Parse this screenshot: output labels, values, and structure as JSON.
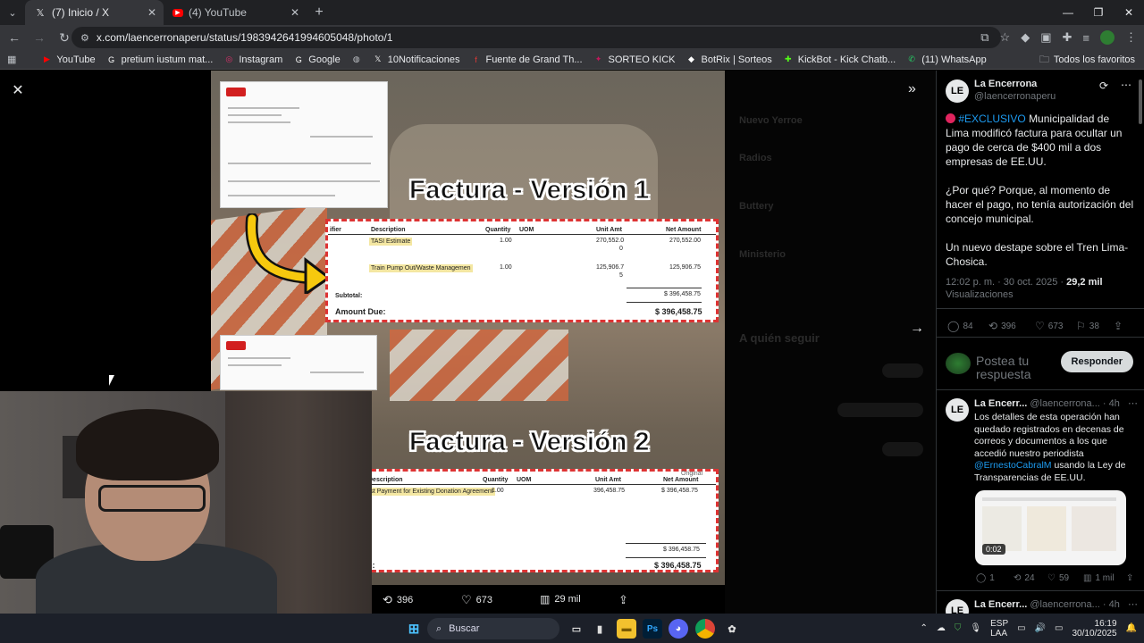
{
  "browser": {
    "tabs": [
      {
        "title": "(7) Inicio / X",
        "favicon": "x-logo-icon",
        "active": true
      },
      {
        "title": "(4) YouTube",
        "favicon": "youtube-icon",
        "active": false
      }
    ],
    "url": "x.com/laencerronaperu/status/1983942641994605048/photo/1",
    "bookmarks": [
      {
        "label": "YouTube",
        "icon": "youtube-icon",
        "color": "#ff0000"
      },
      {
        "label": "pretium iustum mat...",
        "icon": "google-icon",
        "color": "#ffffff"
      },
      {
        "label": "Instagram",
        "icon": "instagram-icon",
        "color": "#e1306c"
      },
      {
        "label": "Google",
        "icon": "google-icon",
        "color": "#ffffff"
      },
      {
        "label": "",
        "icon": "globe-icon",
        "color": "#bdc1c6"
      },
      {
        "label": "10Notificaciones",
        "icon": "x-logo-icon",
        "color": "#ffffff"
      },
      {
        "label": "Fuente de Grand Th...",
        "icon": "flag-icon",
        "color": "#e53935"
      },
      {
        "label": "SORTEO KICK",
        "icon": "gift-icon",
        "color": "#c2185b"
      },
      {
        "label": "BotRix | Sorteos",
        "icon": "diamond-icon",
        "color": "#ffffff"
      },
      {
        "label": "KickBot - Kick Chatb...",
        "icon": "bot-icon",
        "color": "#53fc18"
      },
      {
        "label": "(11) WhatsApp",
        "icon": "whatsapp-icon",
        "color": "#25d366"
      }
    ],
    "bookmarks_folder": "Todos los favoritos"
  },
  "photo": {
    "title_v1": "Factura - Versión 1",
    "title_v2": "Factura - Versión 2",
    "invoice1": {
      "headers": [
        "Description",
        "Quantity",
        "UOM",
        "Unit Amt",
        "Net Amount"
      ],
      "partial_header": "ifier",
      "rows": [
        {
          "desc": "TASI Estimate",
          "qty": "1.00",
          "unit": "270,552.0",
          "unit2": "0",
          "net": "270,552.00"
        },
        {
          "desc": "Train Pump Out/Waste Managemen",
          "qty": "1.00",
          "unit": "125,906.7",
          "unit2": "5",
          "net": "125,906.75"
        }
      ],
      "subtotal_label": "Subtotal:",
      "subtotal": "$ 396,458.75",
      "amount_due_label": "Amount Due:",
      "amount_due": "$ 396,458.75"
    },
    "invoice2": {
      "headers": [
        "Description",
        "Quantity",
        "UOM",
        "Unit Amt",
        "Net Amount"
      ],
      "origin_label": "Original",
      "row": {
        "desc": "rst Payment for Existing Donation Agreement",
        "qty": "1.00",
        "unit": "396,458.75",
        "net": "$ 396,458.75"
      },
      "subtotal": "$ 396,458.75",
      "amount_due_label": "ue:",
      "amount_due": "$ 396,458.75"
    },
    "actions": {
      "retweets": "396",
      "likes": "673",
      "views": "29 mil"
    }
  },
  "tweet": {
    "author_name": "La Encerrona",
    "author_handle": "@laencerronaperu",
    "text_tag": "#EXCLUSIVO",
    "text_1": "Municipalidad de Lima modificó factura para ocultar un pago de cerca de $400 mil a dos empresas de EE.UU.",
    "text_2": "¿Por qué? Porque, al momento de hacer el pago, no tenía autorización del concejo municipal.",
    "text_3": "Un nuevo destape sobre el Tren Lima-Chosica.",
    "time": "12:02 p. m. · 30 oct. 2025 ·",
    "views": "29,2 mil",
    "views_label": "Visualizaciones",
    "metrics": {
      "replies": "84",
      "retweets": "396",
      "likes": "673",
      "bookmarks": "38"
    },
    "reply_placeholder": "Postea tu respuesta",
    "reply_button": "Responder"
  },
  "reply": {
    "author_name": "La Encerr...",
    "author_handle": "@laencerrona...",
    "age": "· 4h",
    "text": "Los detalles de esta operación han quedado registrados en decenas de correos y documentos a los que accedió nuestro periodista",
    "mention": "@ErnestoCabralM",
    "text_after": "usando la Ley de Transparencias de EE.UU.",
    "video_duration": "0:02",
    "metrics": {
      "replies": "1",
      "retweets": "24",
      "likes": "59",
      "views": "1 mil"
    }
  },
  "reply2": {
    "author_name": "La Encerr...",
    "author_handle": "@laencerrona...",
    "age": "· 4h"
  },
  "background": {
    "labels": [
      "Nuevo Yerroe",
      "Radios",
      "Buttery",
      "Ministerio",
      "A quién seguir"
    ]
  },
  "taskbar": {
    "search_placeholder": "Buscar",
    "language": "ESP",
    "language_sub": "LAA",
    "time": "16:19",
    "date": "30/10/2025"
  }
}
